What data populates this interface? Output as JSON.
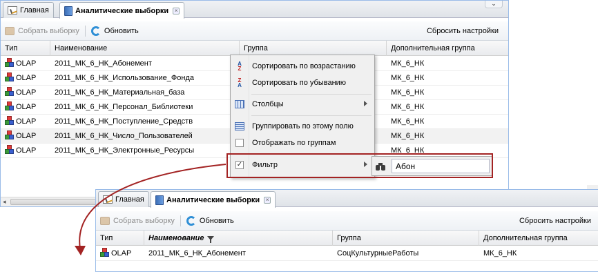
{
  "window1": {
    "tabs": [
      {
        "label": "Главная",
        "icon": "home-icon"
      },
      {
        "label": "Аналитические выборки",
        "icon": "document-icon",
        "close": "×"
      }
    ],
    "scroll_glyph": "⌄",
    "toolbar": {
      "collect_label": "Собрать выборку",
      "refresh_label": "Обновить",
      "reset_label": "Сбросить настройки"
    },
    "columns": [
      "Тип",
      "Наименование",
      "Группа",
      "Дополнительная группа"
    ],
    "rows": [
      {
        "type": "OLAP",
        "name": "2011_МК_6_НК_Абонемент",
        "extra": "МК_6_НК"
      },
      {
        "type": "OLAP",
        "name": "2011_МК_6_НК_Использование_Фонда",
        "extra": "МК_6_НК"
      },
      {
        "type": "OLAP",
        "name": "2011_МК_6_НК_Материальная_база",
        "extra": "МК_6_НК"
      },
      {
        "type": "OLAP",
        "name": "2011_МК_6_НК_Персонал_Библиотеки",
        "extra": "МК_6_НК"
      },
      {
        "type": "OLAP",
        "name": "2011_МК_6_НК_Поступление_Средств",
        "extra": "МК_6_НК"
      },
      {
        "type": "OLAP",
        "name": "2011_МК_6_НК_Число_Пользователей",
        "extra": "МК_6_НК"
      },
      {
        "type": "OLAP",
        "name": "2011_МК_6_НК_Электронные_Ресурсы",
        "extra": "МК_6_НК"
      }
    ],
    "scroll_left": "◂"
  },
  "menu": {
    "items": [
      {
        "label": "Сортировать по возрастанию",
        "icon": "sort-asc-icon",
        "glyph_top": "A",
        "glyph_bottom": "Z"
      },
      {
        "label": "Сортировать по убыванию",
        "icon": "sort-desc-icon",
        "glyph_top": "Z",
        "glyph_bottom": "A"
      },
      {
        "label": "Столбцы",
        "icon": "columns-icon"
      },
      {
        "label": "Группировать по этому полю",
        "icon": "group-icon"
      },
      {
        "label": "Отображать по группам",
        "icon": "checkbox-icon",
        "checked": false
      },
      {
        "label": "Фильтр",
        "icon": "checkbox-icon",
        "checked": true,
        "check_glyph": "✓"
      }
    ],
    "filter_value": "Абон"
  },
  "window2": {
    "tabs": [
      {
        "label": "Главная",
        "icon": "home-icon"
      },
      {
        "label": "Аналитические выборки",
        "icon": "document-icon",
        "close": "×"
      }
    ],
    "toolbar": {
      "collect_label": "Собрать выборку",
      "refresh_label": "Обновить",
      "reset_label": "Сбросить настройки"
    },
    "columns": [
      "Тип",
      "Наименование",
      "Группа",
      "Дополнительная группа"
    ],
    "rows": [
      {
        "type": "OLAP",
        "name": "2011_МК_6_НК_Абонемент",
        "group": "СоцКультурныеРаботы",
        "extra": "МК_6_НК"
      }
    ]
  },
  "colors": {
    "highlight": "#a32323",
    "accent": "#99bbe8"
  }
}
